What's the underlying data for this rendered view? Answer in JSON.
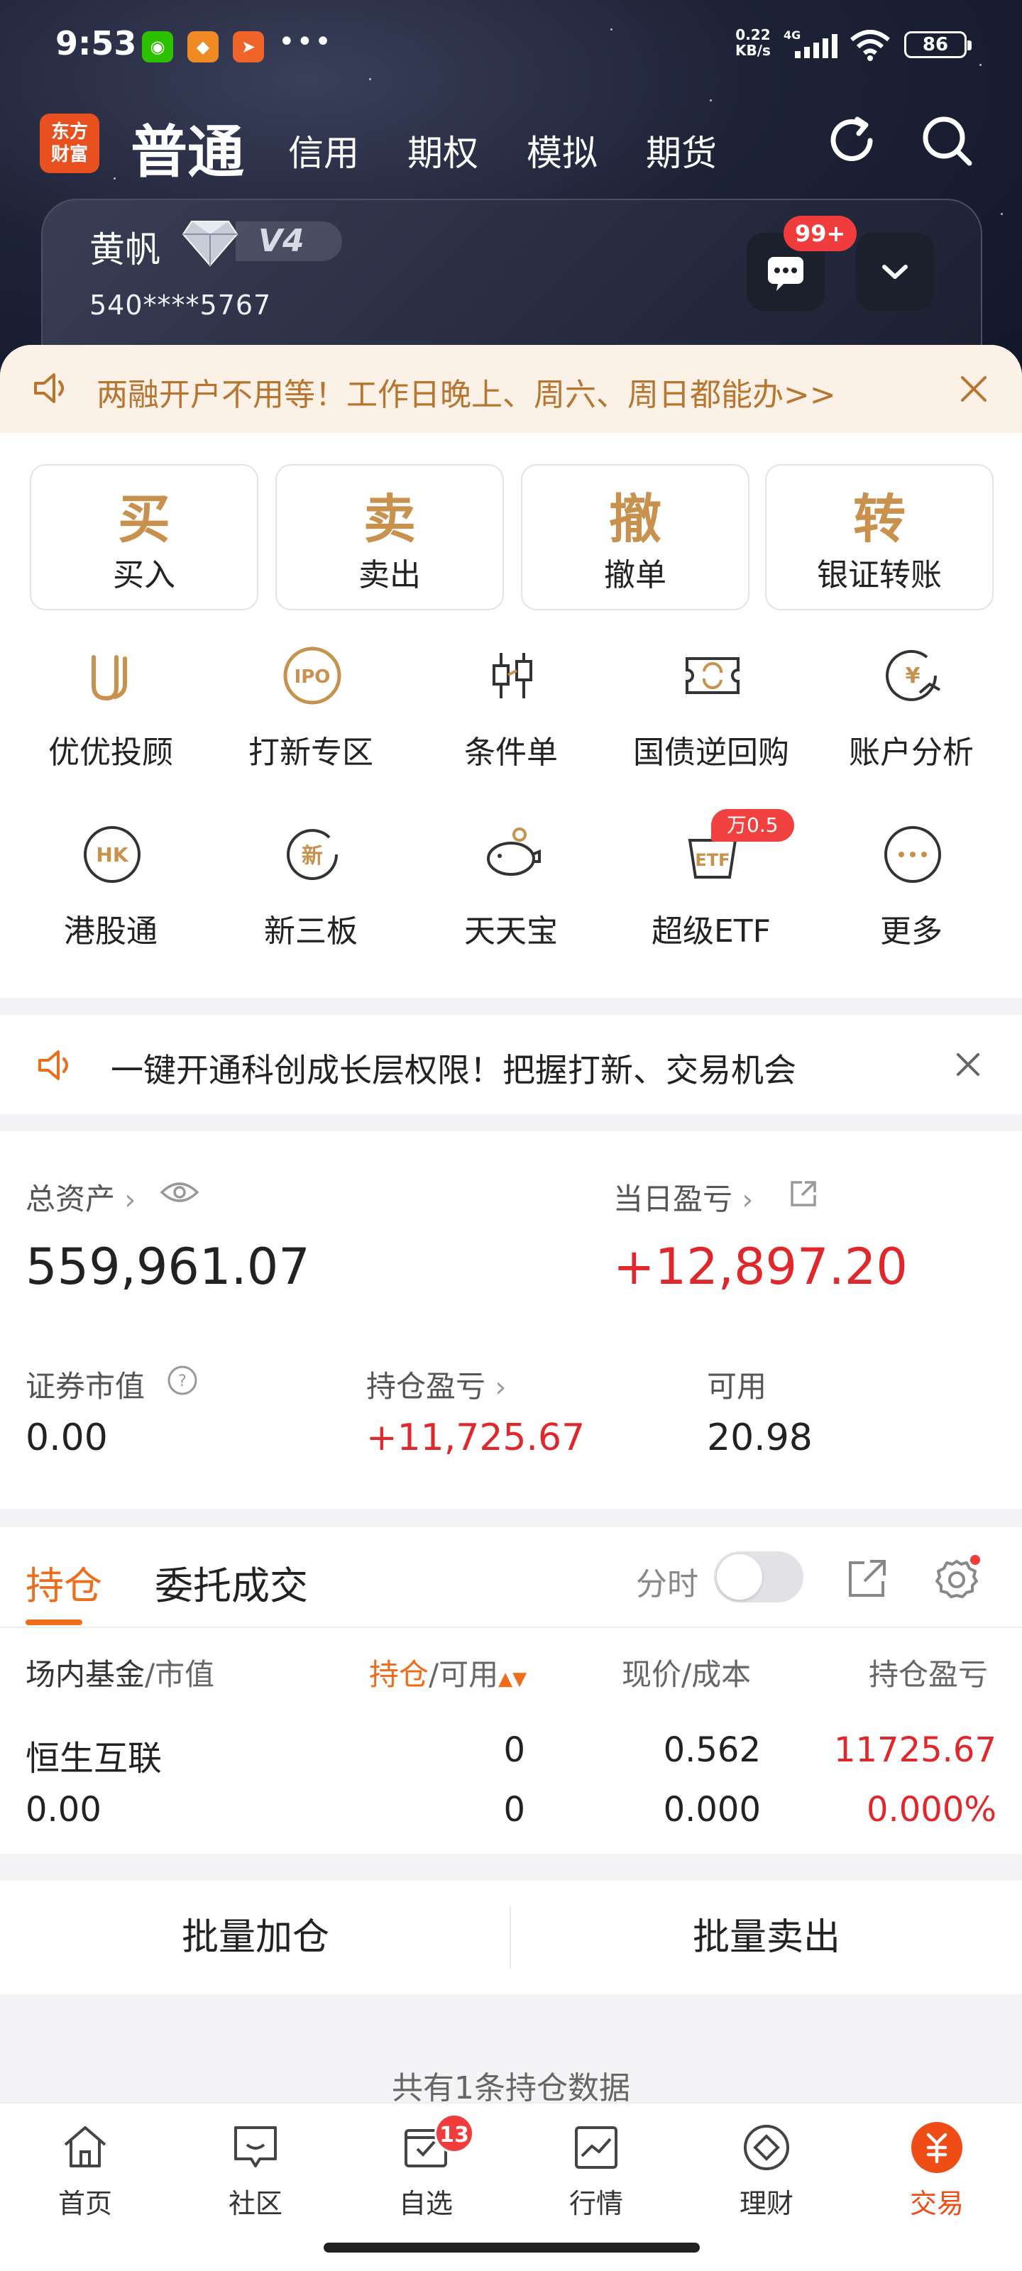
{
  "status_bar": {
    "time": "9:53",
    "more": "•••",
    "net_speed": "0.22\nKB/s",
    "network": "4G",
    "battery": "86"
  },
  "header": {
    "logo_text": "东方\n财富",
    "active_tab": "普通",
    "tabs": [
      "信用",
      "期权",
      "模拟",
      "期货"
    ]
  },
  "account": {
    "name": "黄帆",
    "level": "V4",
    "number": "540****5767",
    "message_badge": "99+"
  },
  "notice_top": {
    "text": "两融开户不用等！工作日晚上、周六、周日都能办>>"
  },
  "trade_buttons": [
    {
      "glyph": "买",
      "label": "买入"
    },
    {
      "glyph": "卖",
      "label": "卖出"
    },
    {
      "glyph": "撤",
      "label": "撤单"
    },
    {
      "glyph": "转",
      "label": "银证转账"
    }
  ],
  "functions": [
    {
      "label": "优优投顾",
      "icon": "uu-advisor-icon"
    },
    {
      "label": "打新专区",
      "icon": "ipo-icon"
    },
    {
      "label": "条件单",
      "icon": "condition-order-icon"
    },
    {
      "label": "国债逆回购",
      "icon": "bond-repo-icon"
    },
    {
      "label": "账户分析",
      "icon": "account-analysis-icon"
    },
    {
      "label": "港股通",
      "icon": "hk-connect-icon"
    },
    {
      "label": "新三板",
      "icon": "neeq-icon"
    },
    {
      "label": "天天宝",
      "icon": "piggy-bank-icon"
    },
    {
      "label": "超级ETF",
      "icon": "etf-icon"
    },
    {
      "label": "更多",
      "icon": "more-icon"
    }
  ],
  "etf_badge": "万0.5",
  "icon_texts": {
    "ipo": "IPO",
    "hk": "HK",
    "neeq": "新",
    "etf": "ETF",
    "yen": "¥"
  },
  "notice_mid": {
    "text": "一键开通科创成长层权限！把握打新、交易机会"
  },
  "assets": {
    "total_label": "总资产",
    "total_value": "559,961.07",
    "daily_pl_label": "当日盈亏",
    "daily_pl_value": "+12,897.20",
    "market_value_label": "证券市值",
    "market_value": "0.00",
    "position_pl_label": "持仓盈亏",
    "position_pl_value": "+11,725.67",
    "available_label": "可用",
    "available_value": "20.98"
  },
  "holdings": {
    "tab_active": "持仓",
    "tab_other": "委托成交",
    "intraday_label": "分时",
    "columns": {
      "name": "场内基金",
      "name_sub": "/市值",
      "qty": "持仓",
      "qty_sub": "/可用",
      "price": "现价/成本",
      "pl": "持仓盈亏"
    },
    "rows": [
      {
        "name": "恒生互联",
        "market_value": "0.00",
        "qty": "0",
        "available": "0",
        "price": "0.562",
        "cost": "0.000",
        "pl": "11725.67",
        "pl_pct": "0.000%"
      }
    ]
  },
  "batch": {
    "add": "批量加仓",
    "sell": "批量卖出"
  },
  "count_note": "共有1条持仓数据",
  "tabbar": [
    {
      "label": "首页",
      "icon": "home-icon"
    },
    {
      "label": "社区",
      "icon": "community-icon"
    },
    {
      "label": "自选",
      "icon": "watchlist-icon",
      "badge": "13"
    },
    {
      "label": "行情",
      "icon": "market-icon"
    },
    {
      "label": "理财",
      "icon": "wealth-icon"
    },
    {
      "label": "交易",
      "icon": "trade-icon",
      "active": true
    }
  ],
  "colors": {
    "accent": "#ef6c1a",
    "red": "#e0272c",
    "gold": "#c8914e",
    "notice_text": "#b8752f"
  }
}
